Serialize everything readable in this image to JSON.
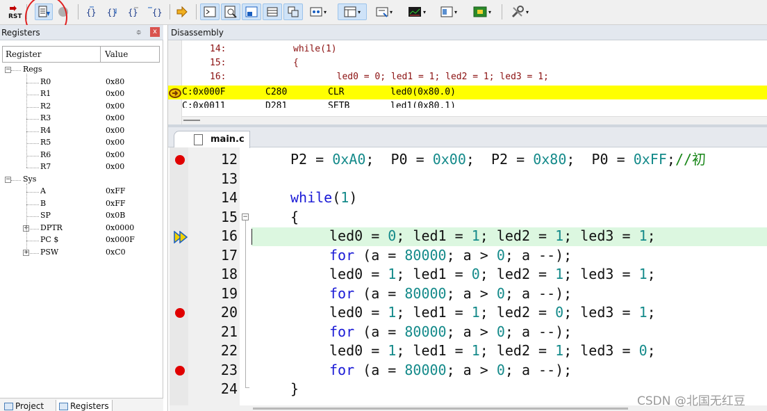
{
  "toolbar": {
    "buttons": [
      {
        "name": "reset-icon",
        "label": "RST"
      },
      {
        "name": "run-icon"
      },
      {
        "name": "stop-icon"
      },
      {
        "name": "step-icon",
        "label": "{}"
      },
      {
        "name": "step-over-icon",
        "label": "{}"
      },
      {
        "name": "step-out-icon",
        "label": "{}"
      },
      {
        "name": "run-to-cursor-icon",
        "label": "{}"
      },
      {
        "name": "show-next-statement-icon"
      },
      {
        "name": "command-window-icon"
      },
      {
        "name": "disassembly-window-icon"
      },
      {
        "name": "symbols-window-icon"
      },
      {
        "name": "registers-window-icon"
      },
      {
        "name": "call-stack-window-icon"
      },
      {
        "name": "watch-window-icon"
      },
      {
        "name": "memory-window-icon"
      },
      {
        "name": "serial-window-icon"
      },
      {
        "name": "analysis-window-icon"
      },
      {
        "name": "trace-window-icon"
      },
      {
        "name": "system-viewer-icon"
      },
      {
        "name": "toolbox-icon"
      }
    ],
    "annotation_color": "#e02020"
  },
  "registers_panel": {
    "title": "Registers",
    "pin": "⯐",
    "close": "x",
    "columns": [
      "Register",
      "Value"
    ],
    "groups": [
      {
        "name": "Regs",
        "items": [
          {
            "name": "R0",
            "value": "0x80"
          },
          {
            "name": "R1",
            "value": "0x00"
          },
          {
            "name": "R2",
            "value": "0x00"
          },
          {
            "name": "R3",
            "value": "0x00"
          },
          {
            "name": "R4",
            "value": "0x00"
          },
          {
            "name": "R5",
            "value": "0x00"
          },
          {
            "name": "R6",
            "value": "0x00"
          },
          {
            "name": "R7",
            "value": "0x00"
          }
        ]
      },
      {
        "name": "Sys",
        "items": [
          {
            "name": "A",
            "value": "0xFF"
          },
          {
            "name": "B",
            "value": "0xFF"
          },
          {
            "name": "SP",
            "value": "0x0B"
          },
          {
            "name": "DPTR",
            "value": "0x0000",
            "expandable": true
          },
          {
            "name": "PC $",
            "value": "0x000F"
          },
          {
            "name": "PSW",
            "value": "0xC0",
            "expandable": true
          }
        ]
      }
    ],
    "tabs": [
      "Project",
      "Registers"
    ],
    "active_tab": "Registers"
  },
  "disassembly": {
    "title": "Disassembly",
    "source_lines": [
      {
        "num": "14:",
        "code": "while(1)"
      },
      {
        "num": "15:",
        "code": "{"
      },
      {
        "num": "16:",
        "code": "        led0 = 0; led1 = 1; led2 = 1; led3 = 1;"
      }
    ],
    "instructions": [
      {
        "addr": "C:0x000F",
        "opcode": "C280",
        "mnemonic": "CLR",
        "operand": "led0(0x80.0)",
        "current": true
      },
      {
        "addr": "C:0x0011",
        "opcode": "D281",
        "mnemonic": "SETB",
        "operand": "led1(0x80.1)",
        "current": false
      }
    ],
    "highlight_color": "#ffff00"
  },
  "editor": {
    "file_tab": "main.c",
    "current_line": "16",
    "lines": [
      {
        "num": "12",
        "bp": true,
        "indent": 0,
        "parts": [
          [
            "P2 = ",
            ""
          ],
          [
            "0xA0",
            "num"
          ],
          [
            ";  P0 = ",
            ""
          ],
          [
            "0x00",
            "num"
          ],
          [
            ";  P2 = ",
            ""
          ],
          [
            "0x80",
            "num"
          ],
          [
            ";  P0 = ",
            ""
          ],
          [
            "0xFF",
            "num"
          ],
          [
            ";",
            ""
          ],
          [
            "//初",
            "cm"
          ]
        ]
      },
      {
        "num": "13",
        "bp": false,
        "indent": 0,
        "parts": []
      },
      {
        "num": "14",
        "bp": false,
        "indent": 0,
        "parts": [
          [
            "while",
            "kw"
          ],
          [
            "(",
            ""
          ],
          [
            "1",
            "num"
          ],
          [
            ")",
            ""
          ]
        ]
      },
      {
        "num": "15",
        "bp": false,
        "indent": 0,
        "fold": true,
        "parts": [
          [
            "{",
            ""
          ]
        ]
      },
      {
        "num": "16",
        "bp": false,
        "indent": 1,
        "current": true,
        "parts": [
          [
            "led0 = ",
            ""
          ],
          [
            "0",
            "num"
          ],
          [
            "; led1 = ",
            ""
          ],
          [
            "1",
            "num"
          ],
          [
            "; led2 = ",
            ""
          ],
          [
            "1",
            "num"
          ],
          [
            "; led3 = ",
            ""
          ],
          [
            "1",
            "num"
          ],
          [
            ";",
            ""
          ]
        ]
      },
      {
        "num": "17",
        "bp": false,
        "indent": 1,
        "parts": [
          [
            "for",
            "kw"
          ],
          [
            " (a = ",
            ""
          ],
          [
            "80000",
            "num"
          ],
          [
            "; a > ",
            ""
          ],
          [
            "0",
            "num"
          ],
          [
            "; a --);",
            ""
          ]
        ]
      },
      {
        "num": "18",
        "bp": false,
        "indent": 1,
        "parts": [
          [
            "led0 = ",
            ""
          ],
          [
            "1",
            "num"
          ],
          [
            "; led1 = ",
            ""
          ],
          [
            "0",
            "num"
          ],
          [
            "; led2 = ",
            ""
          ],
          [
            "1",
            "num"
          ],
          [
            "; led3 = ",
            ""
          ],
          [
            "1",
            "num"
          ],
          [
            ";",
            ""
          ]
        ]
      },
      {
        "num": "19",
        "bp": false,
        "indent": 1,
        "parts": [
          [
            "for",
            "kw"
          ],
          [
            " (a = ",
            ""
          ],
          [
            "80000",
            "num"
          ],
          [
            "; a > ",
            ""
          ],
          [
            "0",
            "num"
          ],
          [
            "; a --);",
            ""
          ]
        ]
      },
      {
        "num": "20",
        "bp": true,
        "indent": 1,
        "parts": [
          [
            "led0 = ",
            ""
          ],
          [
            "1",
            "num"
          ],
          [
            "; led1 = ",
            ""
          ],
          [
            "1",
            "num"
          ],
          [
            "; led2 = ",
            ""
          ],
          [
            "0",
            "num"
          ],
          [
            "; led3 = ",
            ""
          ],
          [
            "1",
            "num"
          ],
          [
            ";",
            ""
          ]
        ]
      },
      {
        "num": "21",
        "bp": false,
        "indent": 1,
        "parts": [
          [
            "for",
            "kw"
          ],
          [
            " (a = ",
            ""
          ],
          [
            "80000",
            "num"
          ],
          [
            "; a > ",
            ""
          ],
          [
            "0",
            "num"
          ],
          [
            "; a --);",
            ""
          ]
        ]
      },
      {
        "num": "22",
        "bp": false,
        "indent": 1,
        "parts": [
          [
            "led0 = ",
            ""
          ],
          [
            "1",
            "num"
          ],
          [
            "; led1 = ",
            ""
          ],
          [
            "1",
            "num"
          ],
          [
            "; led2 = ",
            ""
          ],
          [
            "1",
            "num"
          ],
          [
            "; led3 = ",
            ""
          ],
          [
            "0",
            "num"
          ],
          [
            ";",
            ""
          ]
        ]
      },
      {
        "num": "23",
        "bp": true,
        "indent": 1,
        "parts": [
          [
            "for",
            "kw"
          ],
          [
            " (a = ",
            ""
          ],
          [
            "80000",
            "num"
          ],
          [
            "; a > ",
            ""
          ],
          [
            "0",
            "num"
          ],
          [
            "; a --);",
            ""
          ]
        ]
      },
      {
        "num": "24",
        "bp": false,
        "indent": 0,
        "foldend": true,
        "parts": [
          [
            "}",
            ""
          ]
        ]
      }
    ],
    "colors": {
      "keyword": "#1a1ad6",
      "number": "#148a8a",
      "comment": "#178517",
      "breakpoint": "#e00000",
      "current_line": "#dcf7e0"
    }
  },
  "watermark": "CSDN @北国无红豆"
}
